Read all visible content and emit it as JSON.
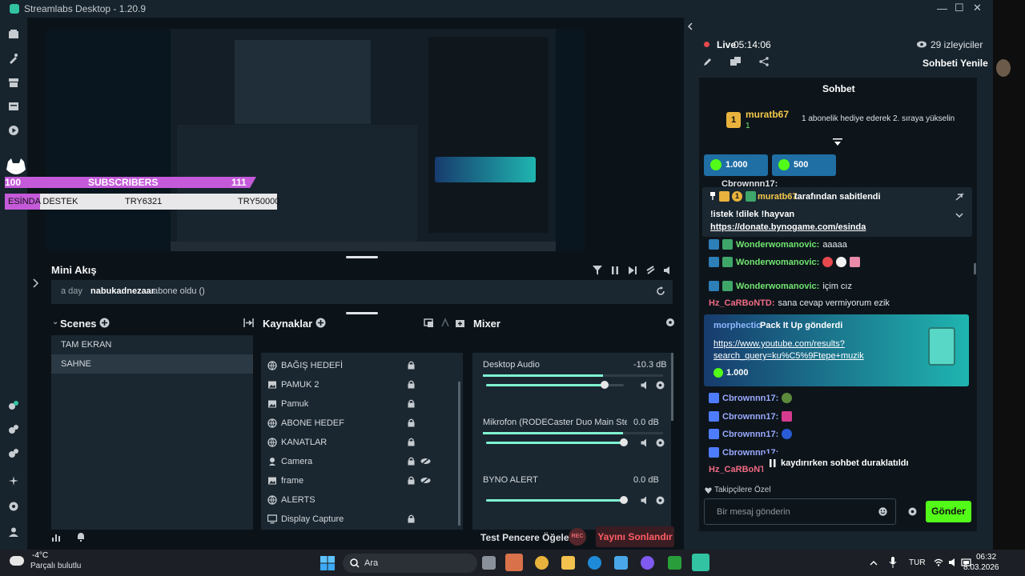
{
  "app": {
    "title": "Streamlabs Desktop - 1.20.9"
  },
  "overlay": {
    "sub_count": "100",
    "sub_label": "SUBSCRIBERS",
    "sub_goal": "111",
    "donate_label": "ESİNDA DESTEK",
    "donate_current": "TRY6321",
    "donate_goal": "TRY50000",
    "donate_fraction": 0.13
  },
  "mini_feed": {
    "title": "Mini Akış",
    "time": "a day",
    "user": "nabukadnezaar",
    "action": "abone oldu ()"
  },
  "scenes": {
    "title": "Scenes",
    "items": [
      {
        "label": "TAM EKRAN"
      },
      {
        "label": "SAHNE"
      }
    ]
  },
  "sources": {
    "title": "Kaynaklar",
    "items": [
      {
        "label": "BAĞIŞ HEDEFİ",
        "icon": "globe-icon"
      },
      {
        "label": "PAMUK 2",
        "icon": "image-icon"
      },
      {
        "label": "Pamuk",
        "icon": "image-icon"
      },
      {
        "label": "ABONE HEDEF",
        "icon": "globe-icon"
      },
      {
        "label": "KANATLAR",
        "icon": "globe-icon"
      },
      {
        "label": "Camera",
        "icon": "camera-icon"
      },
      {
        "label": "frame",
        "icon": "image-icon"
      },
      {
        "label": "ALERTS",
        "icon": "globe-icon"
      },
      {
        "label": "Display Capture",
        "icon": "monitor-icon"
      }
    ]
  },
  "mixer": {
    "title": "Mixer",
    "channels": [
      {
        "name": "Desktop Audio",
        "db": "-10.3 dB",
        "level": 0.86
      },
      {
        "name": "Mikrofon (RODECaster Duo Main Ste...",
        "db": "0.0 dB",
        "level": 1.0
      },
      {
        "name": "BYNO ALERT",
        "db": "0.0 dB",
        "level": 1.0
      }
    ]
  },
  "footer": {
    "test_label": "Test Pencere Öğeleri",
    "rec_label": "REC",
    "end_label": "Yayını Sonlandır"
  },
  "chat": {
    "live_label": "Live",
    "live_time": "05:14:06",
    "viewers": "29 izleyiciler",
    "refresh_label": "Sohbeti Yenile",
    "header": "Sohbet",
    "top_user": "muratb67",
    "top_rank": "1",
    "top_count": "1",
    "top_msg": "1 abonelik hediye ederek 2. sıraya yükselin",
    "kick1": "1.000",
    "kick2": "500",
    "truncated_user": "Cbrownnn17:",
    "pinned_user": "muratb67",
    "pinned_badge": "1",
    "pinned_by": "tarafından sabitlendi",
    "pinned_text": "!istek !dilek !hayvan",
    "pinned_link": "https://donate.bynogame.com/esinda",
    "lines": [
      {
        "user": "Wonderwomanovic:",
        "text": "aaaaa"
      },
      {
        "user": "Wonderwomanovic:",
        "text": ""
      },
      {
        "user": "Wonderwomanovic:",
        "text": "içim cız"
      }
    ],
    "hz_user": "Hz_CaRBoNTD:",
    "hz_text": "sana cevap vermiyorum ezik",
    "gift_user": "morphectic",
    "gift_action": "Pack It Up gönderdi",
    "gift_link1": "https://www.youtube.com/results?",
    "gift_link2": "search_query=ku%C5%9Ftepe+muzik",
    "gift_amount": "1.000",
    "cb_user": "Cbrownnn17:",
    "hz_user2": "Hz_CaRBoNTD",
    "paused": "kaydırırken sohbet duraklatıldı",
    "followers_only": "Takipçilere Özel",
    "input_placeholder": "Bir mesaj gönderin",
    "send_label": "Gönder"
  },
  "taskbar": {
    "temp": "-4°C",
    "weather": "Parçalı bulutlu",
    "search_label": "Ara",
    "lang": "TUR",
    "time": "06:32",
    "date": "8.03.2026"
  },
  "colors": {
    "accent": "#80f5d2",
    "send": "#53fc18",
    "live": "#e5484d",
    "kick": "#53fc18"
  }
}
